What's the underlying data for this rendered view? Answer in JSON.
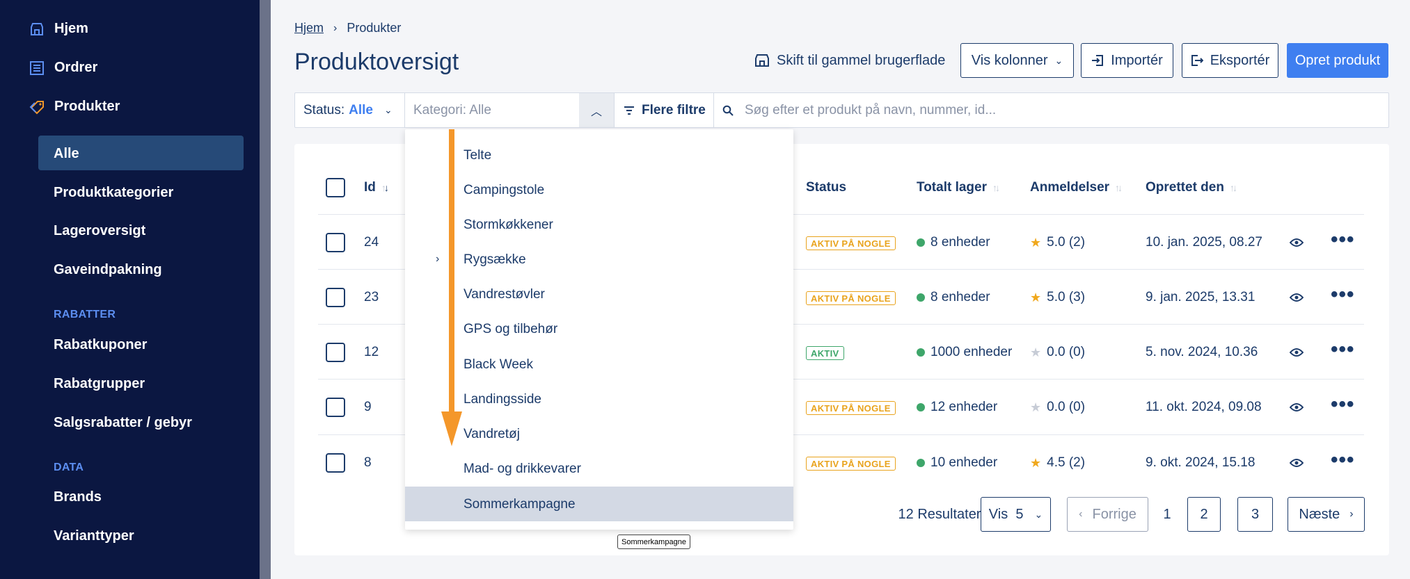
{
  "sidebar": {
    "top_items": [
      {
        "label": "Hjem",
        "icon": "store-icon"
      },
      {
        "label": "Ordrer",
        "icon": "list-icon"
      },
      {
        "label": "Produkter",
        "icon": "tag-icon"
      }
    ],
    "product_items": [
      "Alle",
      "Produktkategorier",
      "Lageroversigt",
      "Gaveindpakning"
    ],
    "section_rabatter": "RABATTER",
    "rabatter_items": [
      "Rabatkuponer",
      "Rabatgrupper",
      "Salgsrabatter / gebyr"
    ],
    "section_data": "DATA",
    "data_items": [
      "Brands",
      "Varianttyper"
    ]
  },
  "breadcrumb": {
    "home": "Hjem",
    "current": "Produkter"
  },
  "page_title": "Produktoversigt",
  "toolbar": {
    "legacy": "Skift til gammel brugerflade",
    "columns": "Vis kolonner",
    "import": "Importér",
    "export": "Eksportér",
    "create": "Opret produkt"
  },
  "filters": {
    "status_label": "Status:",
    "status_value": "Alle",
    "category_placeholder": "Kategori: Alle",
    "more_filters": "Flere filtre",
    "search_placeholder": "Søg efter et produkt på navn, nummer, id..."
  },
  "table": {
    "headers": {
      "id": "Id",
      "status": "Status",
      "stock": "Totalt lager",
      "reviews": "Anmeldelser",
      "created": "Oprettet den"
    },
    "rows": [
      {
        "id": "24",
        "status": "AKTIV PÅ NOGLE",
        "stock": "8 enheder",
        "rating": "5.0 (2)",
        "rated": true,
        "created": "10. jan. 2025, 08.27"
      },
      {
        "id": "23",
        "status": "AKTIV PÅ NOGLE",
        "stock": "8 enheder",
        "rating": "5.0 (3)",
        "rated": true,
        "created": "9. jan. 2025, 13.31"
      },
      {
        "id": "12",
        "status": "AKTIV",
        "stock": "1000 enheder",
        "rating": "0.0 (0)",
        "rated": false,
        "created": "5. nov. 2024, 10.36"
      },
      {
        "id": "9",
        "status": "AKTIV PÅ NOGLE",
        "stock": "12 enheder",
        "rating": "0.0 (0)",
        "rated": false,
        "created": "11. okt. 2024, 09.08"
      },
      {
        "id": "8",
        "status": "AKTIV PÅ NOGLE",
        "stock": "10 enheder",
        "rating": "4.5 (2)",
        "rated": true,
        "created": "9. okt. 2024, 15.18"
      }
    ]
  },
  "pagination": {
    "results": "12 Resultater",
    "per_page": "Vis  5",
    "prev": "Forrige",
    "pages": [
      "1",
      "2",
      "3"
    ],
    "next": "Næste"
  },
  "dropdown": {
    "items": [
      "Telte",
      "Campingstole",
      "Stormkøkkener",
      "Rygsække",
      "Vandrestøvler",
      "GPS og tilbehør",
      "Black Week",
      "Landingsside",
      "Vandretøj",
      "Mad- og drikkevarer",
      "Sommerkampagne"
    ],
    "selected": "Sommerkampagne",
    "tooltip": "Sommerkampagne"
  },
  "colors": {
    "sidebar_bg": "#0b1741",
    "accent": "#3f7ff0",
    "badge_partial": "#e9a31c",
    "badge_active": "#3ea66a",
    "star_filled": "#f0a81d",
    "star_empty": "#c7ccd6",
    "scroll_arrow": "#f4972a"
  }
}
